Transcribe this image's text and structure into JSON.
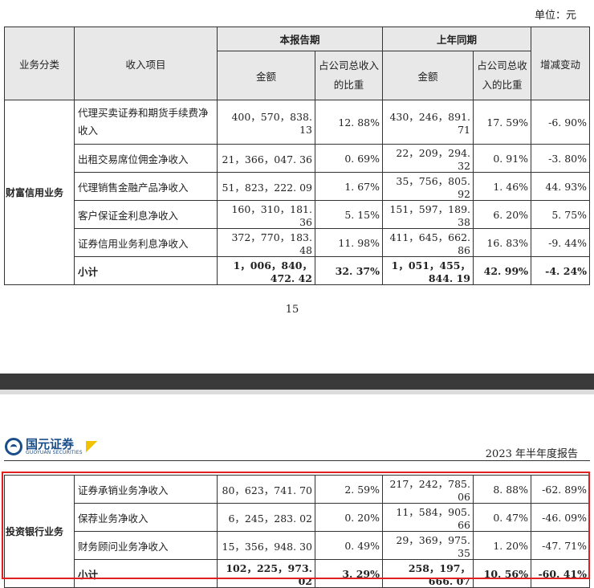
{
  "unit_label": "单位：元",
  "page_number": "15",
  "report_title": "2023 年半年度报告",
  "logo": {
    "cn": "国元证券",
    "en": "GUOYUAN SECURITIES"
  },
  "header": {
    "category": "业务分类",
    "item": "收入项目",
    "current_period": "本报告期",
    "prior_period": "上年同期",
    "amount": "金额",
    "share": "占公司总收入的比重",
    "change": "增减变动"
  },
  "wealth": {
    "category": "财富信用业务",
    "rows": [
      {
        "item": "代理买卖证券和期货手续费净收入",
        "cur_amount": "400，570，838. 13",
        "cur_share": "12. 88%",
        "prior_amount": "430，246，891. 71",
        "prior_share": "17. 59%",
        "change": "-6. 90%"
      },
      {
        "item": "出租交易席位佣金净收入",
        "cur_amount": "21，366，047. 36",
        "cur_share": "0. 69%",
        "prior_amount": "22，209，294. 32",
        "prior_share": "0. 91%",
        "change": "-3. 80%"
      },
      {
        "item": "代理销售金融产品净收入",
        "cur_amount": "51，823，222. 09",
        "cur_share": "1. 67%",
        "prior_amount": "35，756，805. 92",
        "prior_share": "1. 46%",
        "change": "44. 93%"
      },
      {
        "item": "客户保证金利息净收入",
        "cur_amount": "160，310，181. 36",
        "cur_share": "5. 15%",
        "prior_amount": "151，597，189. 38",
        "prior_share": "6. 20%",
        "change": "5. 75%"
      },
      {
        "item": "证券信用业务利息净收入",
        "cur_amount": "372，770，183. 48",
        "cur_share": "11. 98%",
        "prior_amount": "411，645，662. 86",
        "prior_share": "16. 83%",
        "change": "-9. 44%"
      }
    ],
    "subtotal": {
      "item": "小计",
      "cur_amount": "1，006，840，472. 42",
      "cur_share": "32. 37%",
      "prior_amount": "1，051，455，844. 19",
      "prior_share": "42. 99%",
      "change": "-4. 24%"
    }
  },
  "ib": {
    "category": "投资银行业务",
    "rows": [
      {
        "item": "证券承销业务净收入",
        "cur_amount": "80，623，741. 70",
        "cur_share": "2. 59%",
        "prior_amount": "217，242，785. 06",
        "prior_share": "8. 88%",
        "change": "-62. 89%"
      },
      {
        "item": "保荐业务净收入",
        "cur_amount": "6，245，283. 02",
        "cur_share": "0. 20%",
        "prior_amount": "11，584，905. 66",
        "prior_share": "0. 47%",
        "change": "-46. 09%"
      },
      {
        "item": "财务顾问业务净收入",
        "cur_amount": "15，356，948. 30",
        "cur_share": "0. 49%",
        "prior_amount": "29，369，975. 35",
        "prior_share": "1. 20%",
        "change": "-47. 71%"
      }
    ],
    "subtotal": {
      "item": "小计",
      "cur_amount": "102，225，973. 02",
      "cur_share": "3. 29%",
      "prior_amount": "258，197，666. 07",
      "prior_share": "10. 56%",
      "change": "-60. 41%"
    }
  },
  "colors": {
    "highlight_box": "#e02020",
    "header_bg": "#e8e8e8",
    "brand": "#1a4e8a",
    "brand_accent": "#f2c200"
  }
}
